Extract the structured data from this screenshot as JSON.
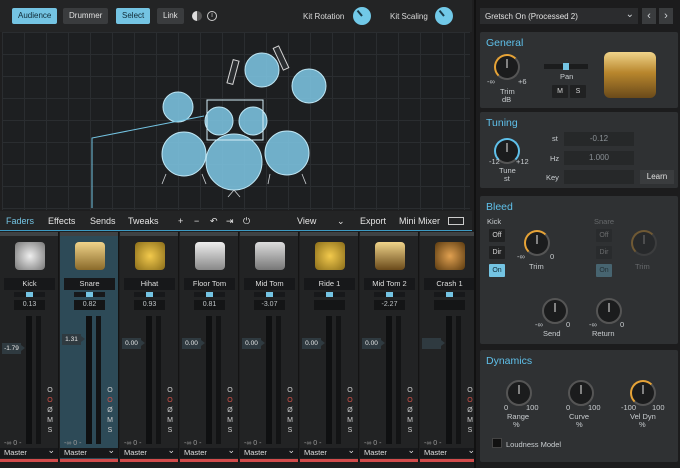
{
  "toolbar": {
    "audience": "Audience",
    "drummer": "Drummer",
    "select": "Select",
    "link": "Link",
    "kit_rotation": "Kit Rotation",
    "kit_scaling": "Kit Scaling"
  },
  "mixer_tabs": {
    "faders": "Faders",
    "effects": "Effects",
    "sends": "Sends",
    "tweaks": "Tweaks",
    "plus": "+",
    "minus": "−",
    "view": "View",
    "export": "Export",
    "mini_mixer": "Mini Mixer"
  },
  "channels": [
    {
      "name": "Kick",
      "pan_val": "0.13",
      "fader_val": "-1.79",
      "fader_level": -1.79,
      "out": "Master",
      "inf": "-∞ 0 -"
    },
    {
      "name": "Snare",
      "pan_val": "0.82",
      "fader_val": "1.31",
      "fader_level": 1.31,
      "out": "Master",
      "inf": "-∞ 0 -"
    },
    {
      "name": "Hihat",
      "pan_val": "0.93",
      "fader_val": "0.00",
      "fader_level": 0,
      "out": "Master",
      "inf": "-∞ 0 -"
    },
    {
      "name": "Floor Tom",
      "pan_val": "0.81",
      "fader_val": "0.00",
      "fader_level": 0,
      "out": "Master",
      "inf": "-∞ 0 -"
    },
    {
      "name": "Mid Tom",
      "pan_val": "-3.07",
      "fader_val": "0.00",
      "fader_level": 0,
      "out": "Master",
      "inf": "-∞ 0 -"
    },
    {
      "name": "Ride 1",
      "pan_val": "",
      "fader_val": "0.00",
      "fader_level": 0,
      "out": "Master",
      "inf": "-∞ 0 -"
    },
    {
      "name": "Mid Tom 2",
      "pan_val": "-2.27",
      "fader_val": "0.00",
      "fader_level": 0,
      "out": "Master",
      "inf": "-∞ 0 -"
    },
    {
      "name": "Crash 1",
      "pan_val": "",
      "fader_val": "",
      "fader_level": 0,
      "out": "Master",
      "inf": "-∞ 0 -"
    }
  ],
  "channel_buttons": {
    "o": "O",
    "phase": "Ø",
    "m": "M",
    "s": "S"
  },
  "panel": {
    "preset": "Gretsch On (Processed 2)",
    "general": {
      "title": "General",
      "trim": "Trim",
      "trim_unit": "dB",
      "trim_min": "-∞",
      "trim_max": "+6",
      "pan": "Pan",
      "m": "M",
      "s": "S"
    },
    "tuning": {
      "title": "Tuning",
      "st_label": "st",
      "st_value": "-0.12",
      "hz_label": "Hz",
      "hz_value": "1.000",
      "key_label": "Key",
      "learn": "Learn",
      "tune": "Tune",
      "tune_unit": "st",
      "tune_min": "-12",
      "tune_max": "+12"
    },
    "bleed": {
      "title": "Bleed",
      "kick": "Kick",
      "snare": "Snare",
      "off": "Off",
      "dir": "Dir",
      "on": "On",
      "trim": "Trim",
      "send": "Send",
      "return": "Return",
      "min": "-∞",
      "zero": "0"
    },
    "dynamics": {
      "title": "Dynamics",
      "range": "Range",
      "curve": "Curve",
      "vel_dyn": "Vel Dyn",
      "pct": "%",
      "zero": "0",
      "hundred": "100",
      "neg_hundred": "-100",
      "loudness": "Loudness Model"
    }
  },
  "colors": {
    "accent": "#74c4e3",
    "title_blue": "#5fc0ea",
    "knob_orange": "#e6a337",
    "record_red": "#d24b4b"
  }
}
